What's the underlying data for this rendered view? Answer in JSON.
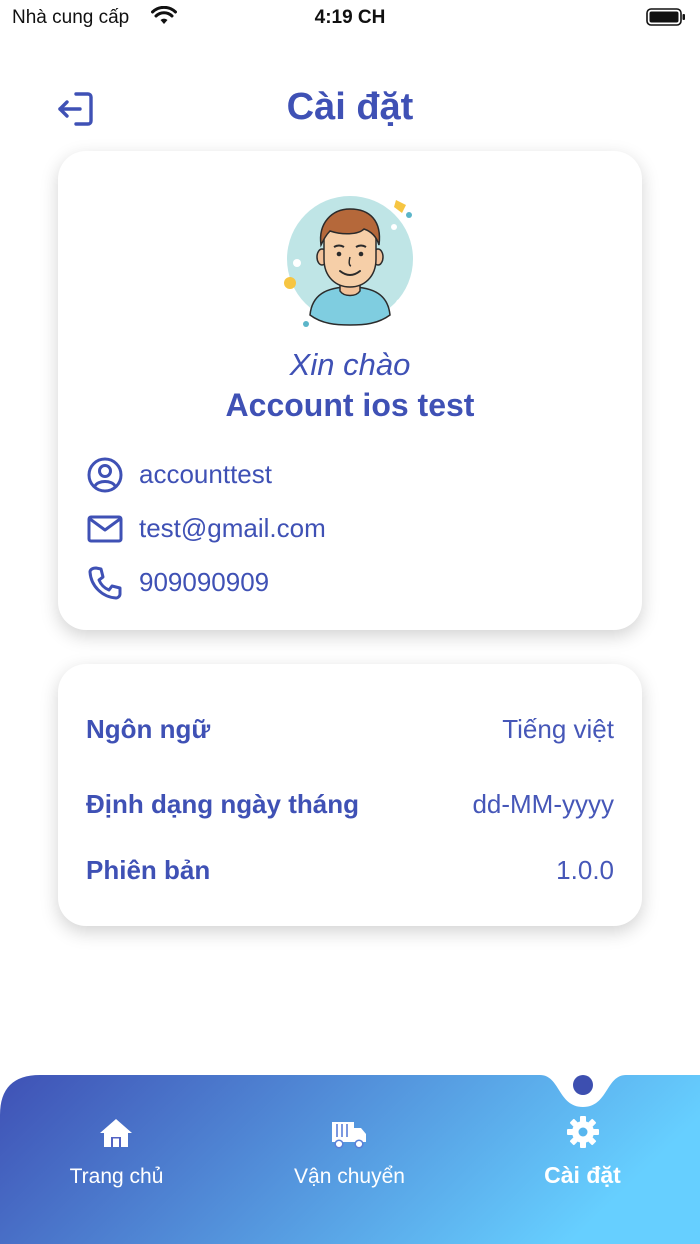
{
  "status_bar": {
    "carrier": "Nhà cung cấp",
    "time": "4:19 CH"
  },
  "header": {
    "title": "Cài đặt",
    "logout_icon": "logout-icon"
  },
  "profile": {
    "greeting": "Xin chào",
    "name": "Account ios test",
    "username": "accounttest",
    "email": "test@gmail.com",
    "phone": "909090909",
    "icons": [
      "user-circle-icon",
      "mail-icon",
      "phone-icon"
    ]
  },
  "settings": {
    "rows": [
      {
        "label": "Ngôn ngữ",
        "value": "Tiếng việt"
      },
      {
        "label": "Định dạng ngày tháng",
        "value": "dd-MM-yyyy"
      },
      {
        "label": "Phiên bản",
        "value": "1.0.0"
      }
    ]
  },
  "nav": {
    "items": [
      {
        "label": "Trang chủ",
        "icon": "home-icon"
      },
      {
        "label": "Vận chuyển",
        "icon": "truck-icon"
      },
      {
        "label": "Cài đặt",
        "icon": "gear-icon"
      }
    ],
    "active_index": 2
  },
  "colors": {
    "accent": "#3f51b5",
    "nav_gradient_start": "#3f51b5",
    "nav_gradient_end": "#66cfff"
  }
}
